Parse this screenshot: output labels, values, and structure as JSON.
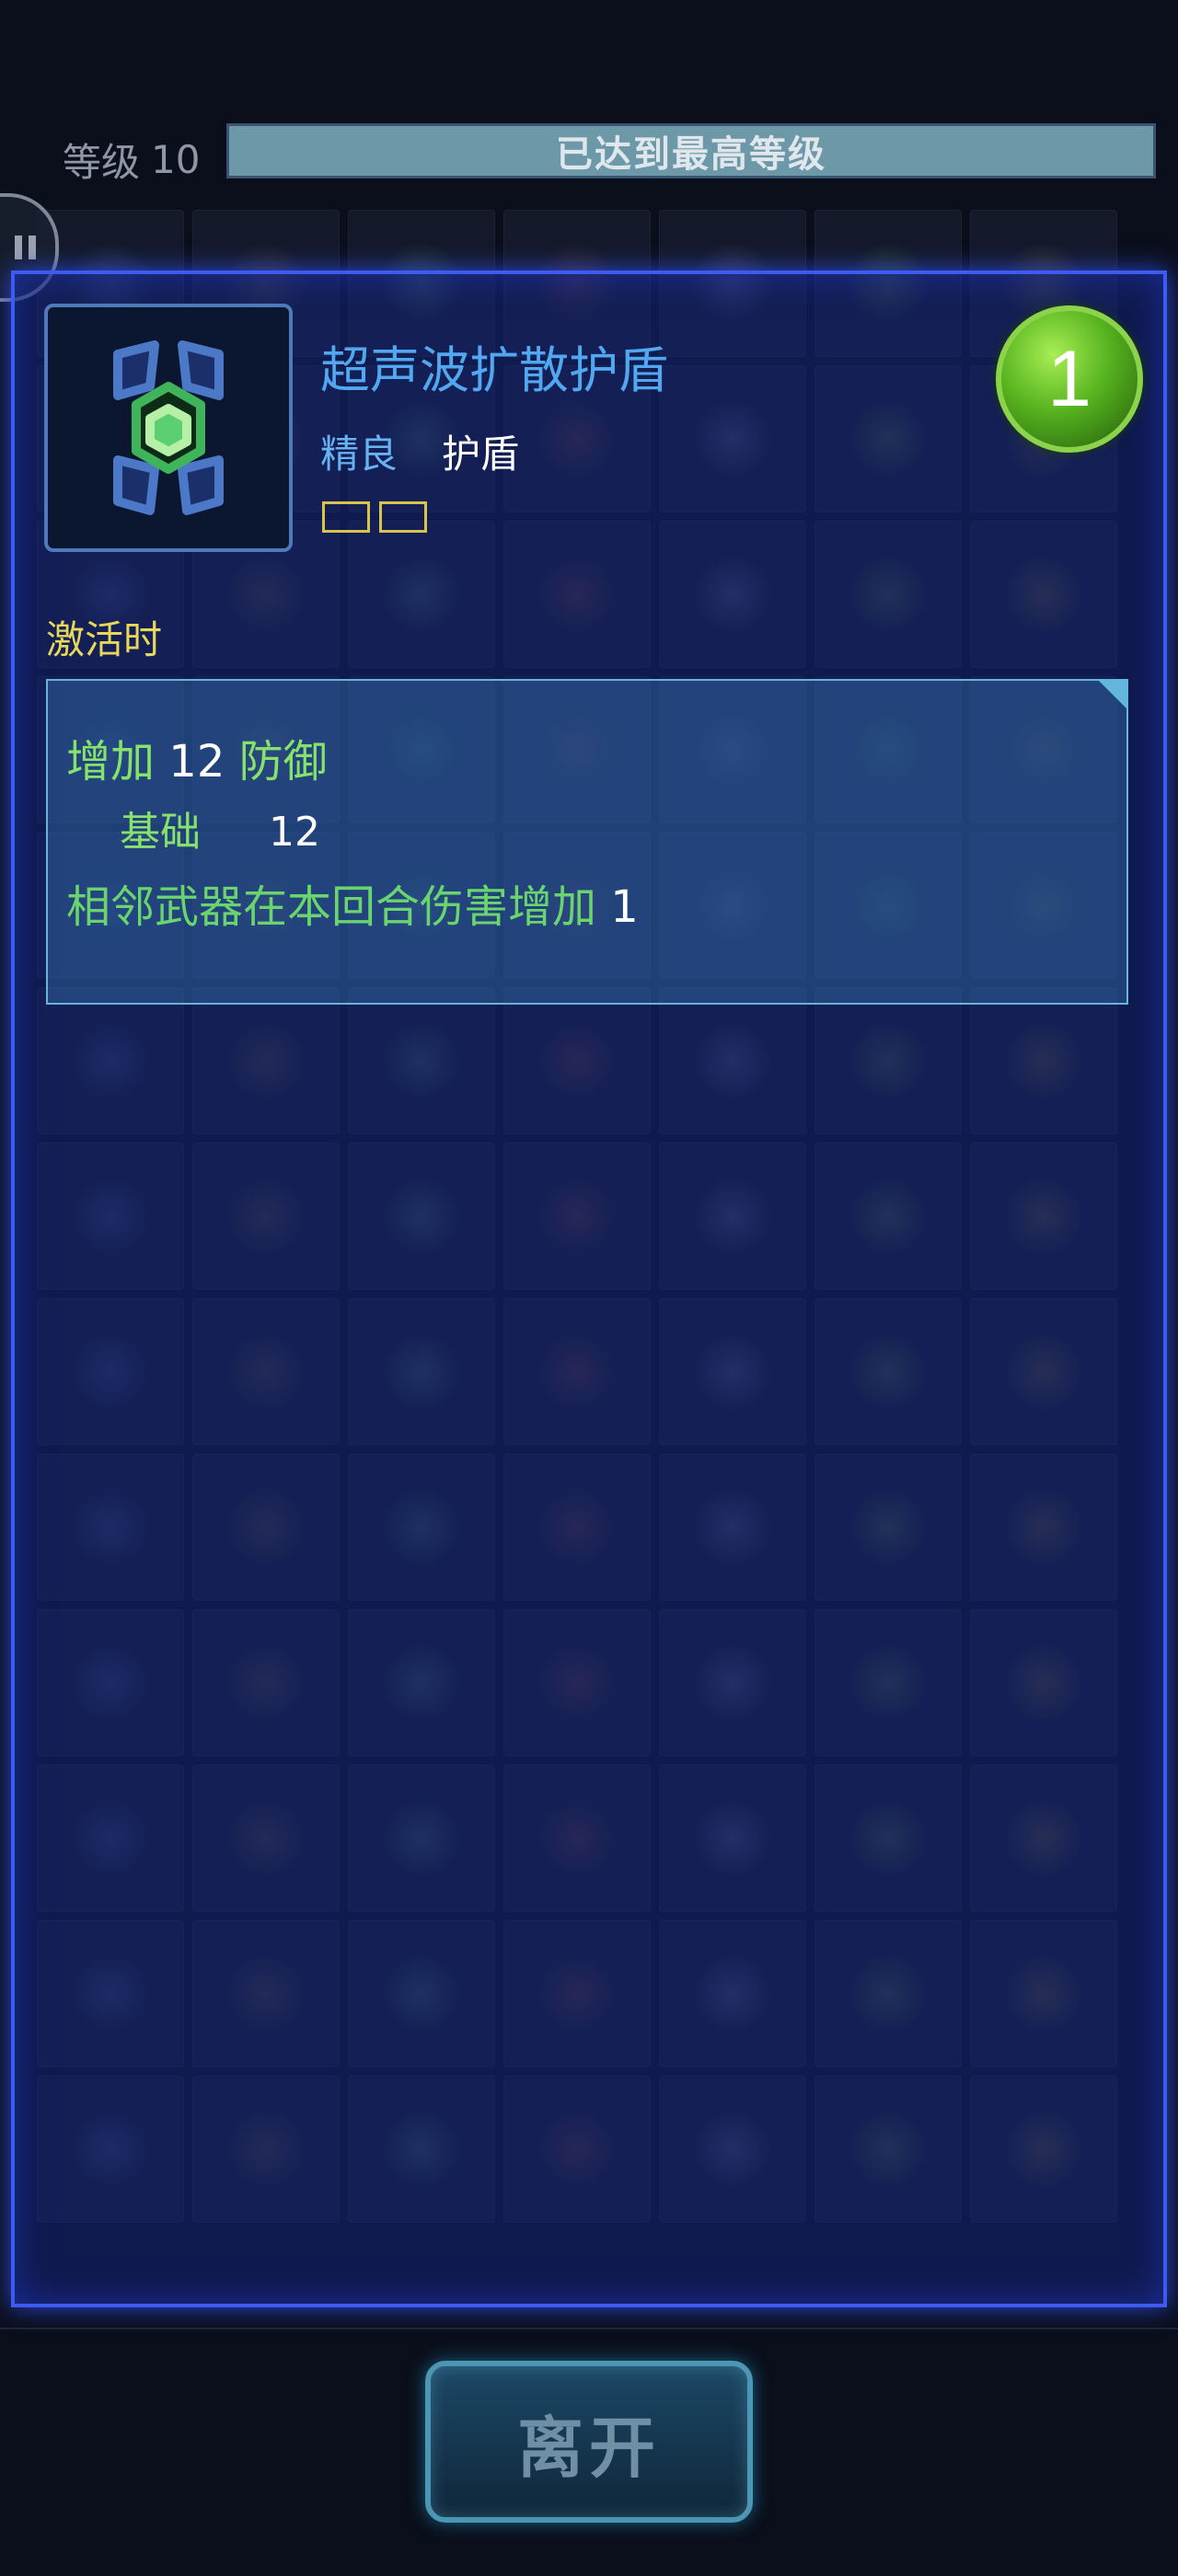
{
  "level": {
    "label": "等级",
    "value": "10",
    "status": "已达到最高等级"
  },
  "item": {
    "name": "超声波扩散护盾",
    "rarity": "精良",
    "type": "护盾",
    "badge_number": "1",
    "slot_count": 2
  },
  "activate": {
    "label": "激活时",
    "line1": {
      "prefix": "增加",
      "value": "12",
      "suffix": "防御"
    },
    "line2": {
      "label": "基础",
      "value": "12"
    },
    "line3": {
      "text": "相邻武器在本回合伤害增加",
      "value": "1"
    }
  },
  "buttons": {
    "leave_label": "离开"
  },
  "colors": {
    "panel_border": "#3d5bf0",
    "rarity_blue": "#66b2f3",
    "effect_green": "#86e26b",
    "badge_green": "#57b31f",
    "title_yellow": "#e7d85c"
  },
  "icons": {
    "pause": "pause-icon",
    "item": "shield-icon"
  }
}
